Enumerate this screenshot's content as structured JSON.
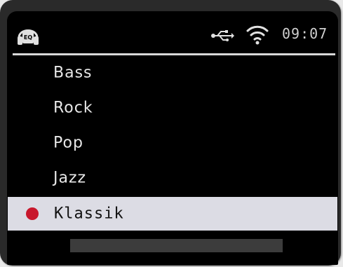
{
  "status_bar": {
    "eq_icon": "eq-headphones-icon",
    "eq_badge_text": "EQ",
    "usb_icon": "usb-icon",
    "wifi_icon": "wifi-icon",
    "time": "09:07"
  },
  "menu": {
    "items": [
      {
        "label": "Bass"
      },
      {
        "label": "Rock"
      },
      {
        "label": "Pop"
      },
      {
        "label": "Jazz"
      },
      {
        "label": "Klassik"
      }
    ],
    "selected_index": 4
  },
  "colors": {
    "screen_bg": "#000000",
    "selection_bg": "#dcdce4",
    "selection_dot": "#c8182c",
    "text": "#e8e8e8"
  }
}
